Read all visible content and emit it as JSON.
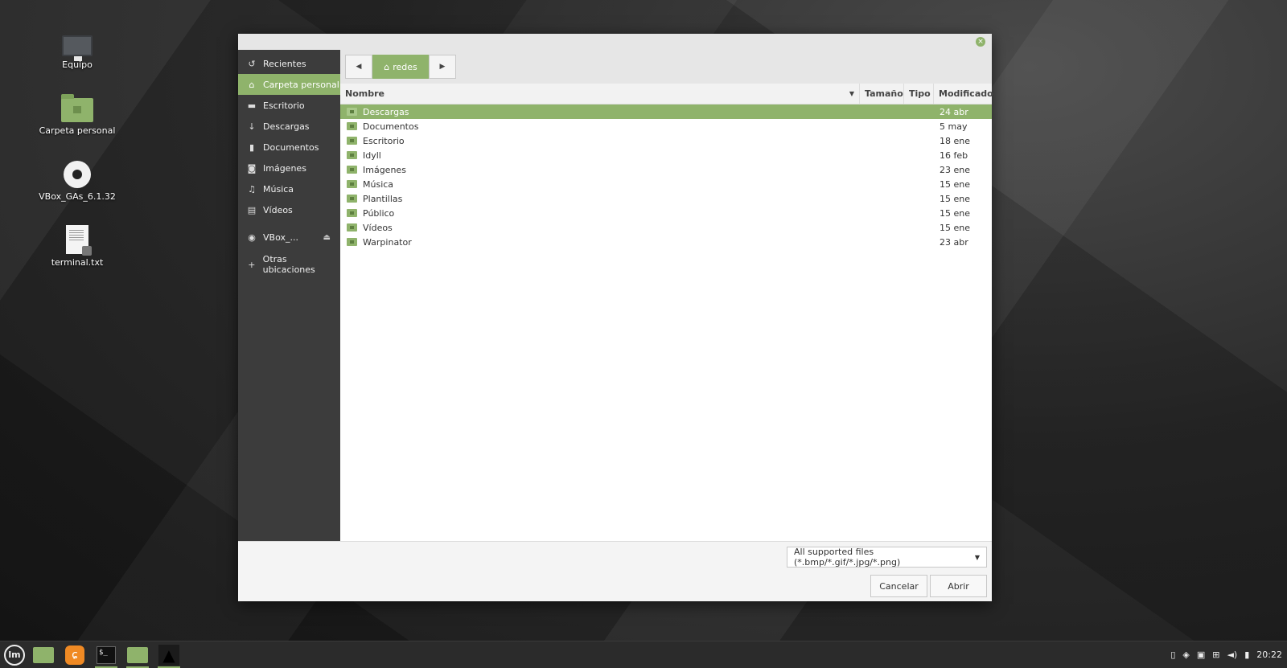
{
  "desktop": {
    "icons": [
      {
        "label": "Equipo"
      },
      {
        "label": "Carpeta personal"
      },
      {
        "label": "VBox_GAs_6.1.32"
      },
      {
        "label": "terminal.txt"
      }
    ]
  },
  "dialog": {
    "close_icon": "×",
    "sidebar": {
      "items": [
        {
          "label": "Recientes",
          "icon": "↺"
        },
        {
          "label": "Carpeta personal",
          "icon": "⌂"
        },
        {
          "label": "Escritorio",
          "icon": "▬"
        },
        {
          "label": "Descargas",
          "icon": "↓"
        },
        {
          "label": "Documentos",
          "icon": "▮"
        },
        {
          "label": "Imágenes",
          "icon": "◙"
        },
        {
          "label": "Música",
          "icon": "♫"
        },
        {
          "label": "Vídeos",
          "icon": "▤"
        },
        {
          "label": "VBox_...",
          "icon": "◉",
          "eject": "⏏"
        },
        {
          "label": "Otras ubicaciones",
          "icon": "+"
        }
      ]
    },
    "pathbar": {
      "back": "◀",
      "forward": "▶",
      "crumb": "redes",
      "home_icon": "⌂"
    },
    "columns": {
      "name": "Nombre",
      "sort_icon": "▼",
      "size": "Tamaño",
      "type": "Tipo",
      "modified": "Modificado"
    },
    "files": [
      {
        "name": "Descargas",
        "modified": "24 abr"
      },
      {
        "name": "Documentos",
        "modified": "5 may"
      },
      {
        "name": "Escritorio",
        "modified": "18 ene"
      },
      {
        "name": "Idyll",
        "modified": "16 feb"
      },
      {
        "name": "Imágenes",
        "modified": "23 ene"
      },
      {
        "name": "Música",
        "modified": "15 ene"
      },
      {
        "name": "Plantillas",
        "modified": "15 ene"
      },
      {
        "name": "Público",
        "modified": "15 ene"
      },
      {
        "name": "Vídeos",
        "modified": "15 ene"
      },
      {
        "name": "Warpinator",
        "modified": "23 abr"
      }
    ],
    "filter": {
      "label": "All supported files (*.bmp/*.gif/*.jpg/*.png)",
      "arrow": "▼"
    },
    "buttons": {
      "cancel": "Cancelar",
      "open": "Abrir"
    }
  },
  "taskbar": {
    "menu_label": "lm",
    "fox_glyph": "ɕ",
    "term_glyph": "$_",
    "spy_glyph": "▲",
    "tray": {
      "clipboard": "▯",
      "shield": "◈",
      "notes": "▣",
      "network": "⊞",
      "volume": "◄)",
      "battery": "▮"
    },
    "clock": "20:22"
  },
  "colors": {
    "accent": "#8fb36b",
    "sidebar": "#3c3c3c",
    "taskbar": "#2b2b2b"
  }
}
